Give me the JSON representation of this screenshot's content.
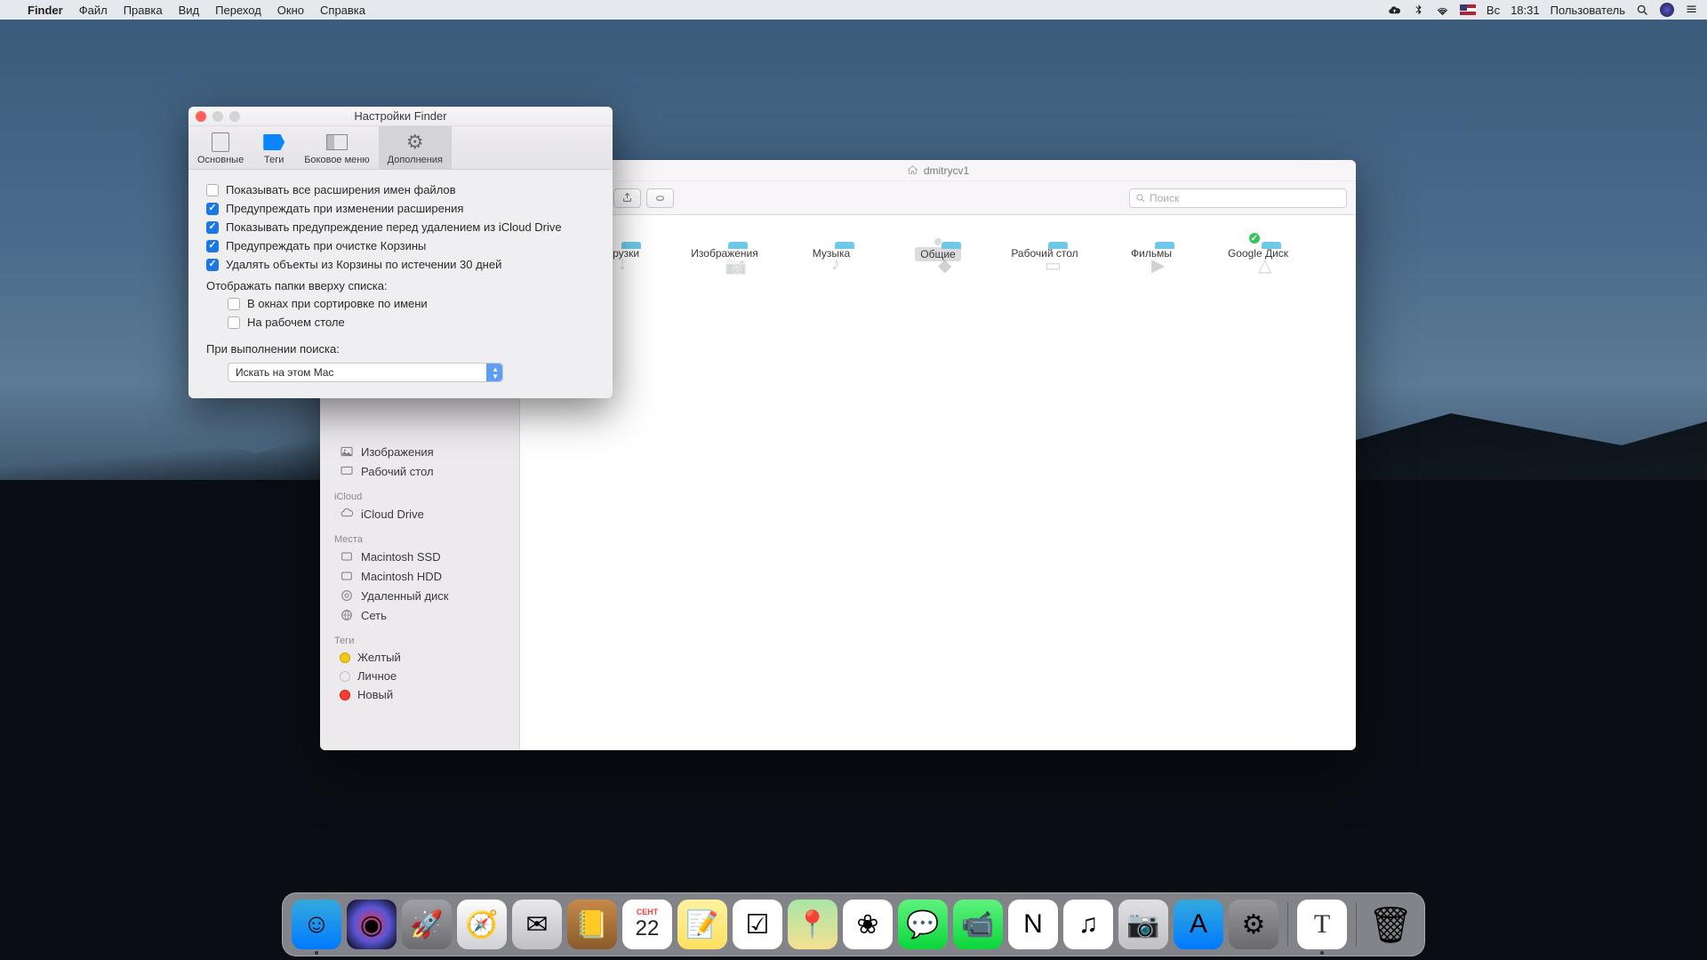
{
  "menubar": {
    "app": "Finder",
    "items": [
      "Файл",
      "Правка",
      "Вид",
      "Переход",
      "Окно",
      "Справка"
    ],
    "day": "Вс",
    "time": "18:31",
    "user": "Пользователь"
  },
  "finder": {
    "path_title": "dmitrycv1",
    "search_placeholder": "Поиск",
    "sidebar": {
      "favorites_items": [
        "Изображения",
        "Рабочий стол"
      ],
      "icloud_head": "iCloud",
      "icloud_items": [
        "iCloud Drive"
      ],
      "places_head": "Места",
      "places_items": [
        "Macintosh SSD",
        "Macintosh HDD",
        "Удаленный диск",
        "Сеть"
      ],
      "tags_head": "Теги",
      "tags": [
        {
          "label": "Желтый",
          "color": "#f5c518"
        },
        {
          "label": "Личное",
          "color": "transparent"
        },
        {
          "label": "Новый",
          "color": "#ff3b30"
        }
      ]
    },
    "folders": [
      {
        "label": "Загрузки",
        "glyph": "↓"
      },
      {
        "label": "Изображения",
        "glyph": "📷"
      },
      {
        "label": "Музыка",
        "glyph": "♪"
      },
      {
        "label": "Общие",
        "glyph": "◆",
        "selected": true
      },
      {
        "label": "Рабочий стол",
        "glyph": "▭"
      },
      {
        "label": "Фильмы",
        "glyph": "▶"
      },
      {
        "label": "Google Диск",
        "glyph": "△",
        "badge": true
      }
    ]
  },
  "prefs": {
    "title": "Настройки Finder",
    "tabs": [
      {
        "label": "Основные"
      },
      {
        "label": "Теги"
      },
      {
        "label": "Боковое меню"
      },
      {
        "label": "Дополнения",
        "active": true
      }
    ],
    "checks": [
      {
        "label": "Показывать все расширения имен файлов",
        "checked": false
      },
      {
        "label": "Предупреждать при изменении расширения",
        "checked": true
      },
      {
        "label": "Показывать предупреждение перед удалением из iCloud Drive",
        "checked": true
      },
      {
        "label": "Предупреждать при очистке Корзины",
        "checked": true
      },
      {
        "label": "Удалять объекты из Корзины по истечении 30 дней",
        "checked": true
      }
    ],
    "folders_top_label": "Отображать папки вверху списка:",
    "sub_checks": [
      {
        "label": "В окнах при сортировке по имени",
        "checked": false
      },
      {
        "label": "На рабочем столе",
        "checked": false
      }
    ],
    "search_label": "При выполнении поиска:",
    "search_option": "Искать на этом Mac"
  },
  "dock": {
    "items": [
      {
        "name": "finder",
        "bg": "linear-gradient(#34aadc,#007aff)",
        "glyph": "☺",
        "running": true
      },
      {
        "name": "siri",
        "bg": "radial-gradient(circle,#ff2d55,#5856d6,#000)",
        "glyph": "◉"
      },
      {
        "name": "launchpad",
        "bg": "linear-gradient(#a0a0a6,#6b6b70)",
        "glyph": "🚀"
      },
      {
        "name": "safari",
        "bg": "linear-gradient(#fefefe,#d0d0d5)",
        "glyph": "🧭"
      },
      {
        "name": "mail",
        "bg": "linear-gradient(#e8e8ec,#c0c0c5)",
        "glyph": "✉"
      },
      {
        "name": "contacts",
        "bg": "linear-gradient(#c68a4a,#8a5a2a)",
        "glyph": "📒"
      },
      {
        "name": "calendar",
        "bg": "#fff",
        "glyph": "22"
      },
      {
        "name": "notes",
        "bg": "linear-gradient(#fff3a0,#ffe060)",
        "glyph": "📝"
      },
      {
        "name": "reminders",
        "bg": "#fff",
        "glyph": "☑"
      },
      {
        "name": "maps",
        "bg": "linear-gradient(#a8e6a8,#f5e090)",
        "glyph": "📍"
      },
      {
        "name": "photos",
        "bg": "#fff",
        "glyph": "❀"
      },
      {
        "name": "messages",
        "bg": "linear-gradient(#5ff27e,#0bd63b)",
        "glyph": "💬"
      },
      {
        "name": "facetime",
        "bg": "linear-gradient(#5ff27e,#0bd63b)",
        "glyph": "📹"
      },
      {
        "name": "news",
        "bg": "#fff",
        "glyph": "N"
      },
      {
        "name": "itunes",
        "bg": "#fff",
        "glyph": "♫"
      },
      {
        "name": "screenshot",
        "bg": "linear-gradient(#e0e0e4,#c0c0c5)",
        "glyph": "📷"
      },
      {
        "name": "appstore",
        "bg": "linear-gradient(#34aadc,#007aff)",
        "glyph": "A"
      },
      {
        "name": "sysprefs",
        "bg": "linear-gradient(#98989c,#6a6a6e)",
        "glyph": "⚙"
      }
    ],
    "items2": [
      {
        "name": "textedit",
        "bg": "#fff",
        "glyph": "T",
        "running": true
      }
    ],
    "trash": {
      "name": "trash",
      "bg": "transparent",
      "glyph": "🗑"
    }
  }
}
